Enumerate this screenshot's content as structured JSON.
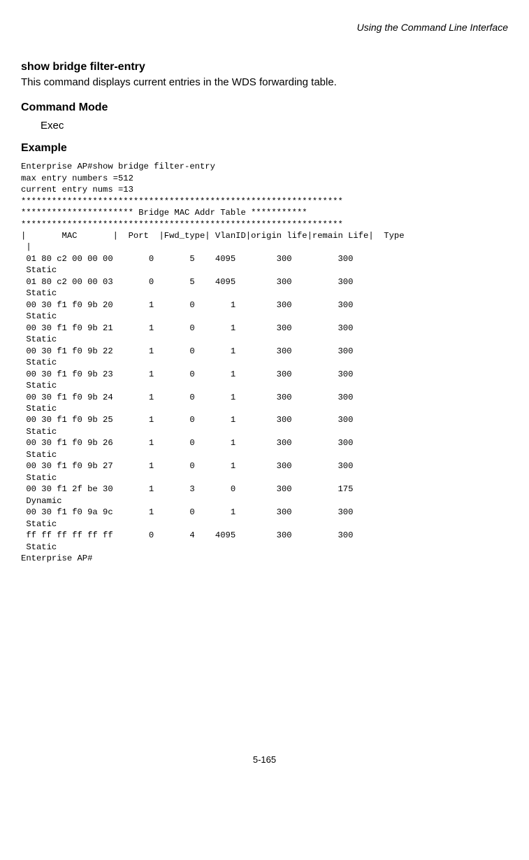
{
  "header": {
    "running": "Using the Command Line Interface"
  },
  "command": {
    "name": "show bridge filter-entry",
    "description": "This command displays current entries in the WDS forwarding table."
  },
  "sections": {
    "mode_heading": "Command Mode",
    "mode_value": "Exec",
    "example_heading": "Example"
  },
  "console": {
    "prompt_line": "Enterprise AP#show bridge filter-entry",
    "max_entries": "max entry numbers =512",
    "current_entries": "current entry nums =13",
    "stars1": "***************************************************************",
    "table_title": "********************** Bridge MAC Addr Table ***********",
    "stars2": "***************************************************************",
    "header1": "|       MAC       |  Port  |Fwd_type| VlanID|origin life|remain Life|  Type ",
    "header2": " |",
    "rows": [
      {
        "mac": "01 80 c2 00 00 00",
        "port": "0",
        "fwd": "5",
        "vlan": "4095",
        "ol": "300",
        "rl": "300",
        "type": "Static"
      },
      {
        "mac": "01 80 c2 00 00 03",
        "port": "0",
        "fwd": "5",
        "vlan": "4095",
        "ol": "300",
        "rl": "300",
        "type": "Static"
      },
      {
        "mac": "00 30 f1 f0 9b 20",
        "port": "1",
        "fwd": "0",
        "vlan": "1",
        "ol": "300",
        "rl": "300",
        "type": "Static"
      },
      {
        "mac": "00 30 f1 f0 9b 21",
        "port": "1",
        "fwd": "0",
        "vlan": "1",
        "ol": "300",
        "rl": "300",
        "type": "Static"
      },
      {
        "mac": "00 30 f1 f0 9b 22",
        "port": "1",
        "fwd": "0",
        "vlan": "1",
        "ol": "300",
        "rl": "300",
        "type": "Static"
      },
      {
        "mac": "00 30 f1 f0 9b 23",
        "port": "1",
        "fwd": "0",
        "vlan": "1",
        "ol": "300",
        "rl": "300",
        "type": "Static"
      },
      {
        "mac": "00 30 f1 f0 9b 24",
        "port": "1",
        "fwd": "0",
        "vlan": "1",
        "ol": "300",
        "rl": "300",
        "type": "Static"
      },
      {
        "mac": "00 30 f1 f0 9b 25",
        "port": "1",
        "fwd": "0",
        "vlan": "1",
        "ol": "300",
        "rl": "300",
        "type": "Static"
      },
      {
        "mac": "00 30 f1 f0 9b 26",
        "port": "1",
        "fwd": "0",
        "vlan": "1",
        "ol": "300",
        "rl": "300",
        "type": "Static"
      },
      {
        "mac": "00 30 f1 f0 9b 27",
        "port": "1",
        "fwd": "0",
        "vlan": "1",
        "ol": "300",
        "rl": "300",
        "type": "Static"
      },
      {
        "mac": "00 30 f1 2f be 30",
        "port": "1",
        "fwd": "3",
        "vlan": "0",
        "ol": "300",
        "rl": "175",
        "type": "Dynamic"
      },
      {
        "mac": "00 30 f1 f0 9a 9c",
        "port": "1",
        "fwd": "0",
        "vlan": "1",
        "ol": "300",
        "rl": "300",
        "type": "Static"
      },
      {
        "mac": "ff ff ff ff ff ff",
        "port": "0",
        "fwd": "4",
        "vlan": "4095",
        "ol": "300",
        "rl": "300",
        "type": "Static"
      }
    ],
    "end_prompt": "Enterprise AP#"
  },
  "footer": {
    "page_number": "5-165"
  }
}
